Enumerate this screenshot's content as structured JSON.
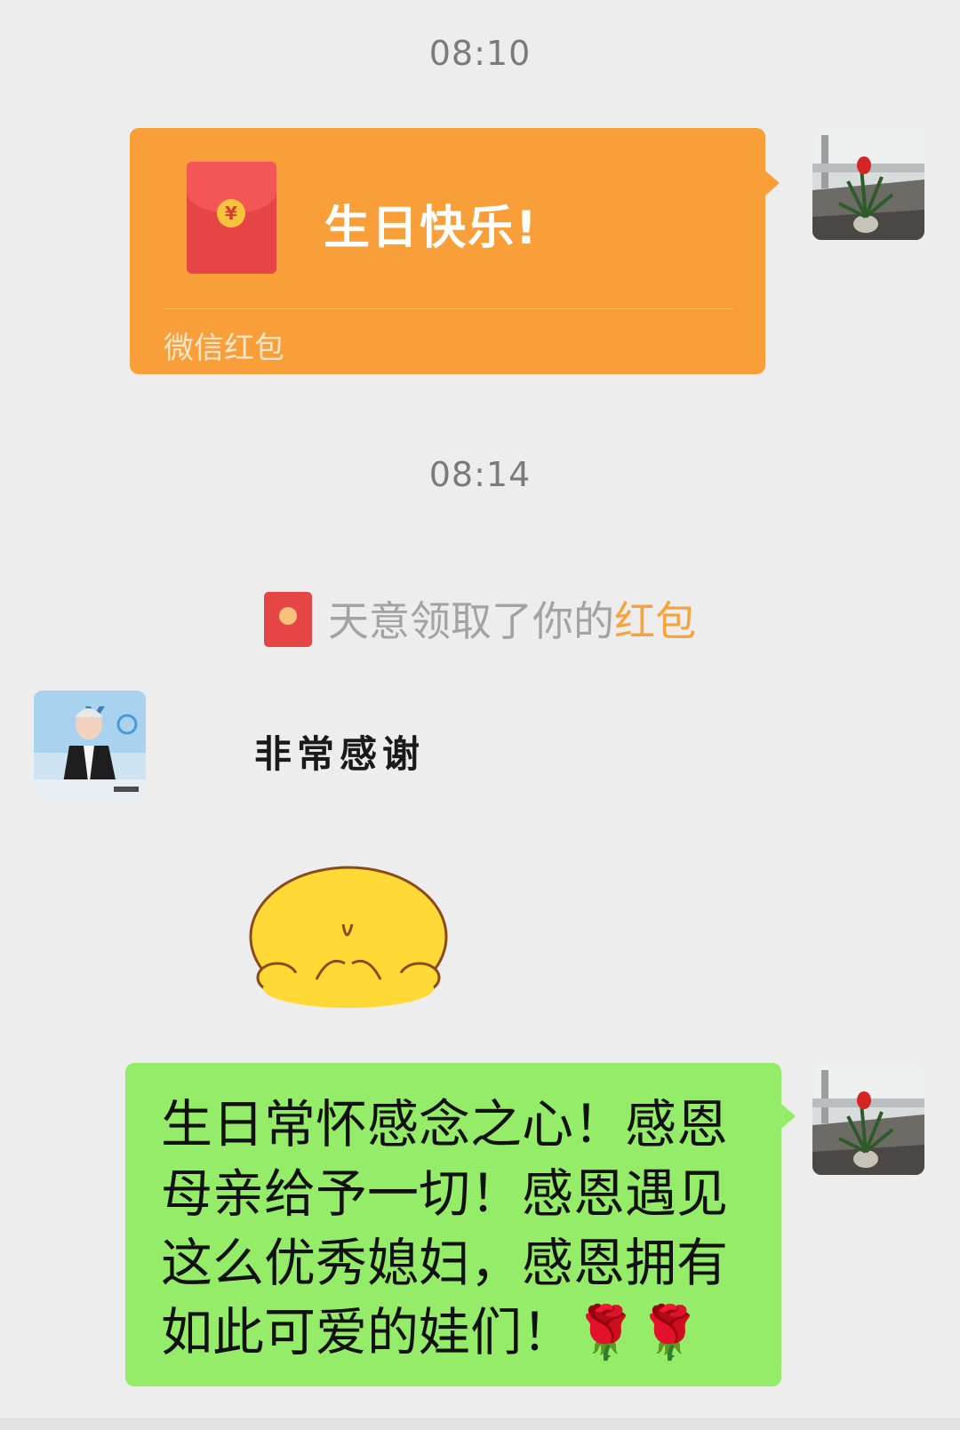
{
  "timestamps": [
    "08:10",
    "08:14"
  ],
  "red_packet": {
    "title": "生日快乐!",
    "coin_symbol": "¥",
    "footer": "微信红包",
    "bubble_color": "#f99f3a",
    "envelope_color": "#e54545"
  },
  "notice": {
    "prefix": "天意领取了你的",
    "link": "红包",
    "link_color": "#f7a33c"
  },
  "incoming": {
    "sticker_caption": "非常感谢"
  },
  "outgoing_message": {
    "text": "生日常怀感念之心！感恩母亲给予一切！感恩遇见这么优秀媳妇，感恩拥有如此可爱的娃们！🌹🌹",
    "bubble_color": "#95ec69"
  },
  "icons": {
    "self_avatar": "potted-plant-avatar-icon",
    "friend_avatar": "child-photo-avatar-icon",
    "sticker": "yellow-chick-sticker-icon",
    "red_packet": "red-envelope-icon"
  }
}
